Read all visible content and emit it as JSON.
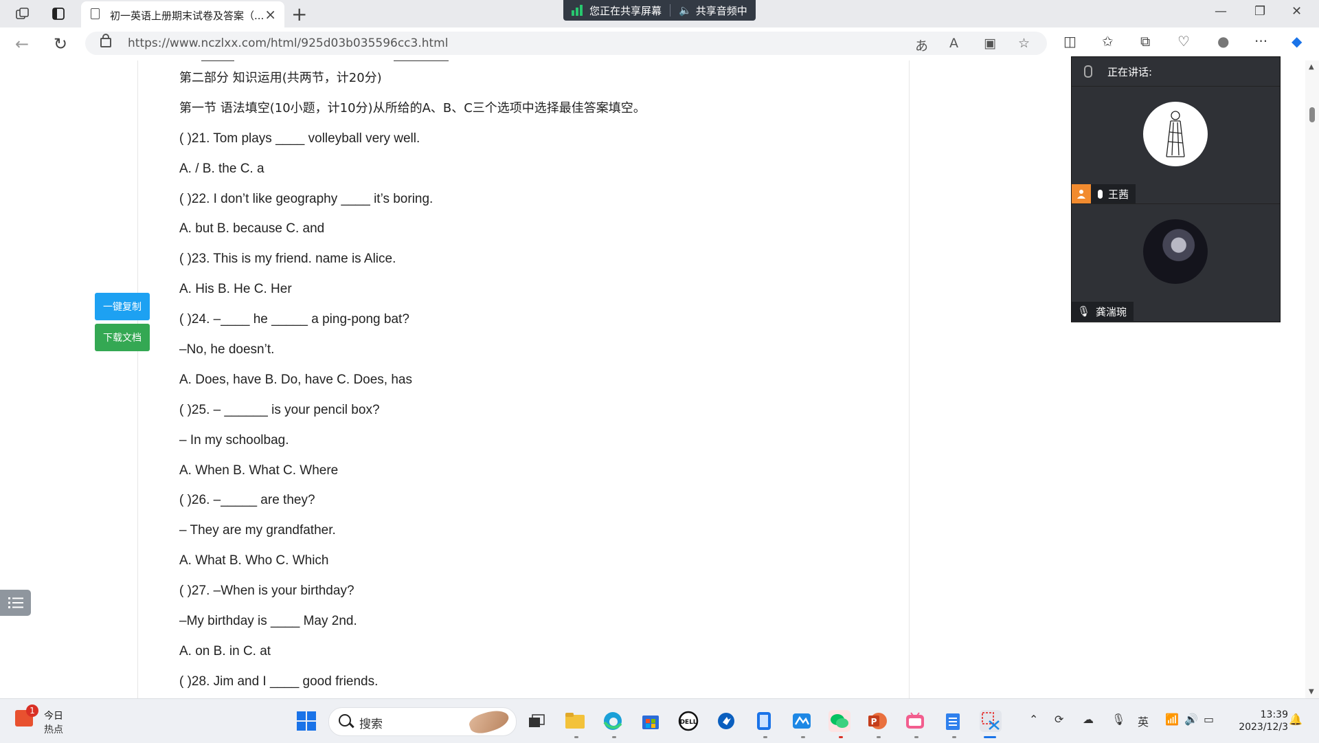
{
  "browser": {
    "tab_title": "初一英语上册期末试卷及答案（...",
    "share_screen": "您正在共享屏幕",
    "share_audio": "共享音频中",
    "url": "https://www.nczlxx.com/html/925d03b035596cc3.html"
  },
  "page": {
    "lines": [
      {
        "text": "第二部分 知识运用(共两节，计20分)",
        "cn": true
      },
      {
        "text": "第一节 语法填空(10小题，计10分)从所给的A、B、C三个选项中选择最佳答案填空。",
        "cn": true
      },
      {
        "text": "( )21. Tom plays ____ volleyball very well."
      },
      {
        "text": "A. / B. the C. a"
      },
      {
        "text": "( )22. I don’t like geography ____ it’s boring."
      },
      {
        "text": "A. but B. because C. and"
      },
      {
        "text": "( )23. This is my friend. name is Alice."
      },
      {
        "text": "A. His B. He C. Her"
      },
      {
        "text": "( )24. –____ he _____ a ping-pong bat?"
      },
      {
        "text": "–No, he doesn’t."
      },
      {
        "text": "A. Does, have B. Do, have C. Does, has"
      },
      {
        "text": "( )25. – ______ is your pencil box?"
      },
      {
        "text": "– In my schoolbag."
      },
      {
        "text": "A. When B. What C. Where"
      },
      {
        "text": "( )26. –_____ are they?"
      },
      {
        "text": "– They are my grandfather."
      },
      {
        "text": "A. What B. Who C. Which"
      },
      {
        "text": "( )27. –When is your birthday?"
      },
      {
        "text": "–My birthday is ____ May 2nd."
      },
      {
        "text": "A. on B. in C. at"
      },
      {
        "text": "( )28. Jim and I ____ good friends."
      }
    ],
    "copy_button": "一键复制",
    "download_button": "下载文档"
  },
  "meeting": {
    "speaking_label": "正在讲话:",
    "participants": [
      {
        "name": "王茜"
      },
      {
        "name": "龚湍琬"
      }
    ]
  },
  "taskbar": {
    "weather_badge": "1",
    "weather_title": "今日",
    "weather_sub": "热点",
    "search_placeholder": "搜索",
    "ime": "英",
    "time": "13:39",
    "date": "2023/12/3"
  }
}
